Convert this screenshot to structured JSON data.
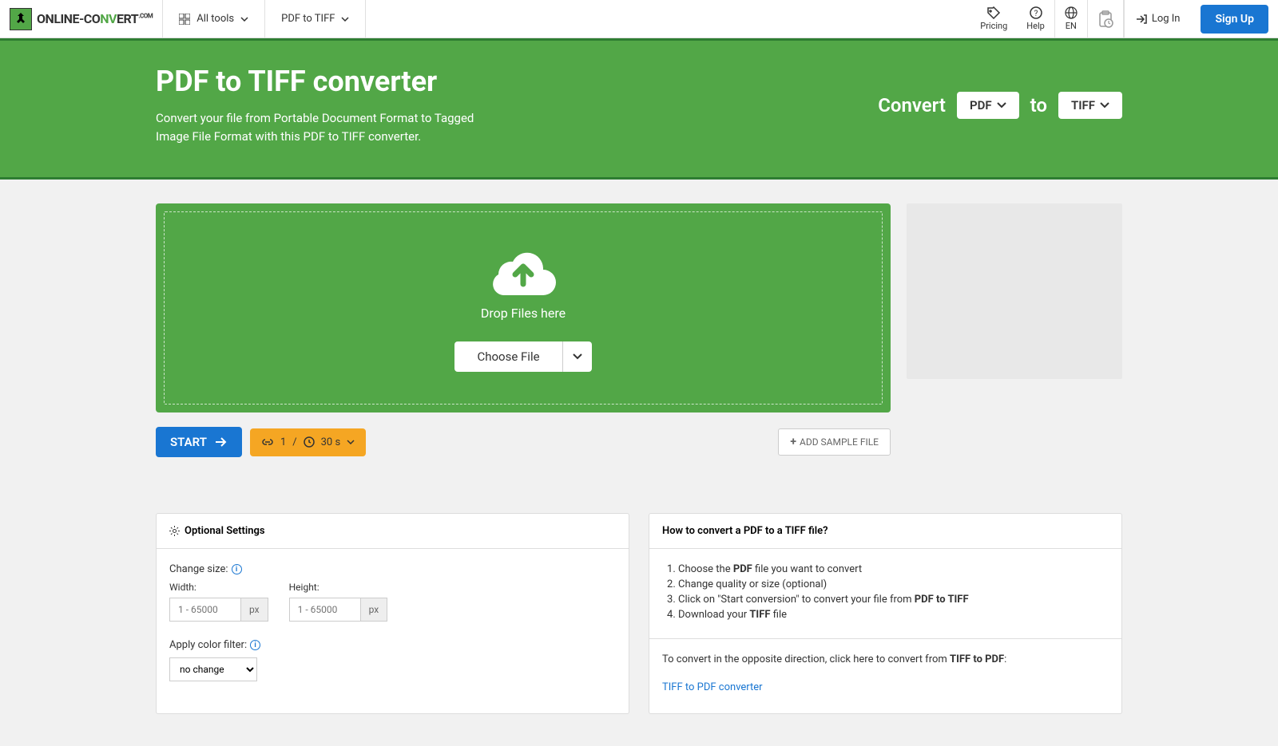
{
  "nav": {
    "all_tools": "All tools",
    "pdf_to_tiff": "PDF to TIFF",
    "pricing": "Pricing",
    "help": "Help",
    "lang": "EN",
    "login": "Log In",
    "signup": "Sign Up"
  },
  "logo": {
    "pre": "ONLINE-CO",
    "mid": "NV",
    "post": "ERT",
    "dotcom": ".COM"
  },
  "hero": {
    "title": "PDF to TIFF converter",
    "desc": "Convert your file from Portable Document Format to Tagged Image File Format with this PDF to TIFF converter.",
    "convert_label": "Convert",
    "to_label": "to",
    "from_fmt": "PDF",
    "to_fmt": "TIFF"
  },
  "dropzone": {
    "drop_text": "Drop Files here",
    "choose_file": "Choose File"
  },
  "toolbar": {
    "start": "START",
    "limit_count": "1",
    "limit_sep": "/",
    "limit_time": "30 s",
    "add_sample": "ADD SAMPLE FILE"
  },
  "settings": {
    "header": "Optional Settings",
    "change_size": "Change size:",
    "width": "Width:",
    "height": "Height:",
    "placeholder": "1 - 65000",
    "px": "px",
    "color_filter": "Apply color filter:",
    "no_change": "no change"
  },
  "howto": {
    "header": "How to convert a PDF to a TIFF file?",
    "step1_a": "Choose the ",
    "step1_b": "PDF",
    "step1_c": " file you want to convert",
    "step2": "Change quality or size (optional)",
    "step3_a": "Click on \"Start conversion\" to convert your file from ",
    "step3_b": "PDF to TIFF",
    "step4_a": "Download your ",
    "step4_b": "TIFF",
    "step4_c": " file"
  },
  "reverse": {
    "text_a": "To convert in the opposite direction, click here to convert from ",
    "text_b": "TIFF to PDF",
    "text_c": ":",
    "link": "TIFF to PDF converter"
  }
}
